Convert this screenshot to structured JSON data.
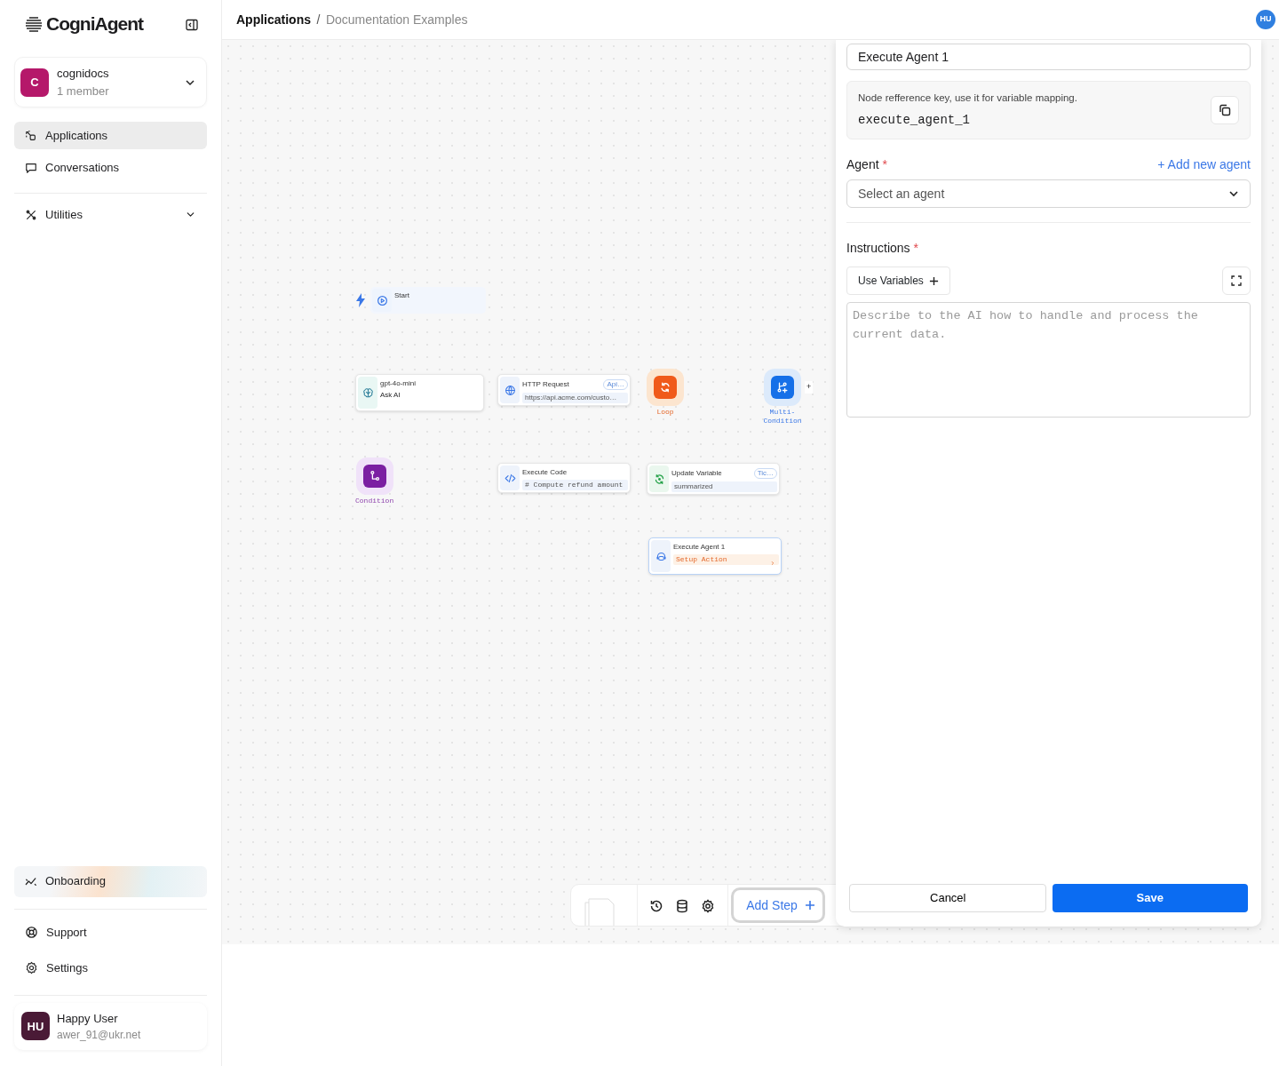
{
  "sidebar": {
    "brand": "CogniAgent",
    "workspace": {
      "initial": "C",
      "name": "cognidocs",
      "members": "1 member"
    },
    "nav": [
      {
        "label": "Applications",
        "selected": true
      },
      {
        "label": "Conversations",
        "selected": false
      }
    ],
    "utilities": {
      "label": "Utilities",
      "expanded": false
    },
    "onboarding": {
      "label": "Onboarding"
    },
    "bottom": [
      {
        "label": "Support"
      },
      {
        "label": "Settings"
      }
    ],
    "user": {
      "initials": "HU",
      "name": "Happy User",
      "email": "awer_91@ukr.net"
    }
  },
  "header": {
    "breadcrumb": [
      {
        "label": "Applications",
        "current": false
      },
      {
        "label": "Documentation Examples",
        "current": true
      }
    ],
    "separator": "/",
    "avatar": "HU"
  },
  "canvas": {
    "nodes": [
      {
        "kind": "start",
        "title": "Start",
        "selected": false
      },
      {
        "kind": "llm",
        "title": "gpt-4o-mini",
        "subtitle": "Ask AI",
        "selected": false
      },
      {
        "kind": "http",
        "title": "HTTP Request",
        "badge": "Api…",
        "subtitle": "https://api.acme.com/custo…",
        "selected": false
      },
      {
        "kind": "loop",
        "title": "Loop",
        "selected": false
      },
      {
        "kind": "multi_condition",
        "title": "Multi-Condition",
        "extra": "+",
        "selected": false
      },
      {
        "kind": "condition",
        "title": "Condition",
        "selected": false
      },
      {
        "kind": "code",
        "title": "Execute Code",
        "subtitle": "# Compute refund amount",
        "selected": false
      },
      {
        "kind": "variable",
        "title": "Update Variable",
        "badge": "Tic…",
        "subtitle": "summarized",
        "selected": false
      },
      {
        "kind": "agent",
        "title": "Execute Agent 1",
        "subtitle": "Setup Action",
        "selected": true
      }
    ]
  },
  "toolbar": {
    "add_step": "Add Step"
  },
  "panel": {
    "name_value": "Execute Agent 1",
    "reference": {
      "hint": "Node refference key, use it for variable mapping.",
      "key": "execute_agent_1"
    },
    "agent": {
      "label": "Agent",
      "required_mark": "*",
      "add_link": "+ Add new agent",
      "placeholder": "Select an agent"
    },
    "instructions": {
      "label": "Instructions",
      "required_mark": "*",
      "use_variables": "Use Variables",
      "placeholder": "Describe to the AI how to handle and process the current data."
    },
    "cancel": "Cancel",
    "save": "Save"
  }
}
